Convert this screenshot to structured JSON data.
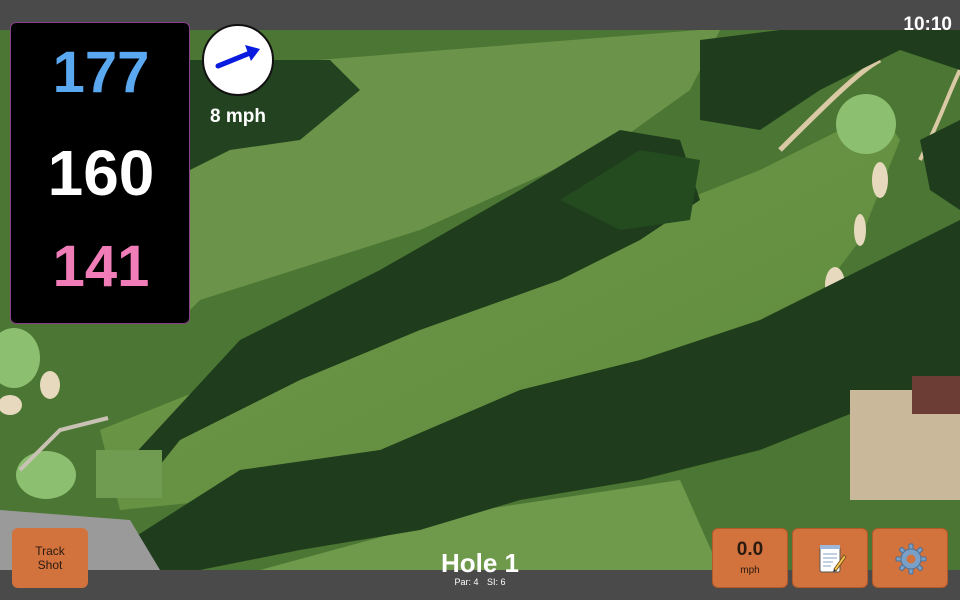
{
  "status": {
    "time": "10:10"
  },
  "distances": {
    "back": "177",
    "middle": "160",
    "front": "141",
    "colors": {
      "back": "#5aa9f0",
      "middle": "#ffffff",
      "front": "#f07cb8"
    }
  },
  "wind": {
    "speed_label": "8 mph",
    "icon": "wind-arrow-icon"
  },
  "hole": {
    "title": "Hole 1",
    "par": "Par: 4",
    "si": "SI: 6"
  },
  "buttons": {
    "track_shot_line1": "Track",
    "track_shot_line2": "Shot",
    "speed_value": "0.0",
    "speed_unit": "mph",
    "notes_icon": "notepad-icon",
    "settings_icon": "gear-icon"
  },
  "colors": {
    "button": "#d2723c",
    "bar": "#4a4a4a"
  }
}
